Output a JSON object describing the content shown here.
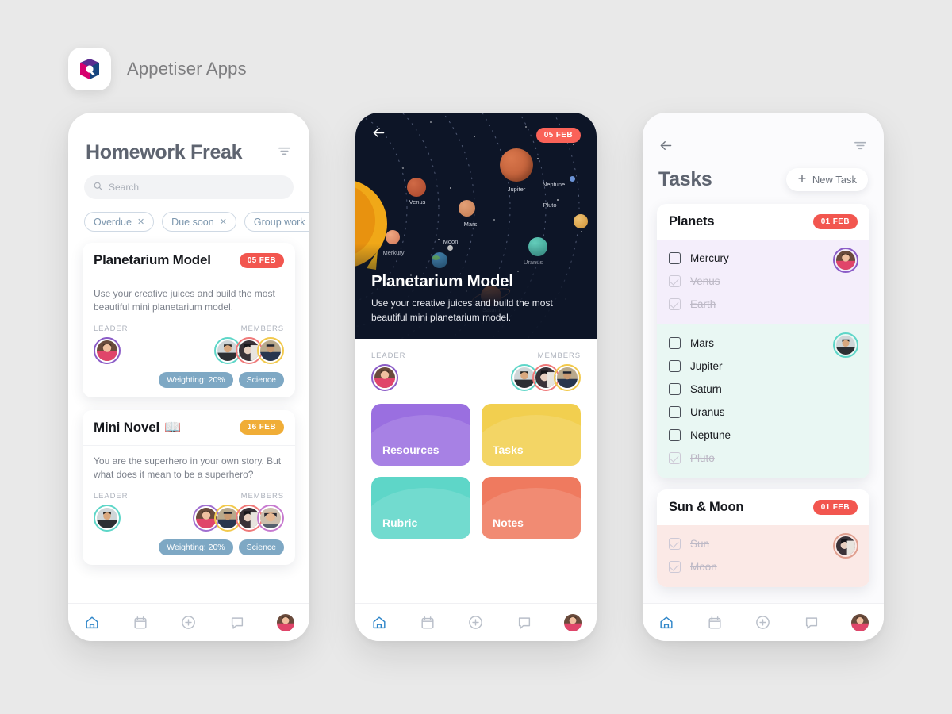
{
  "brand": {
    "name": "Appetiser Apps",
    "logo_icon": "appetiser-logo-icon"
  },
  "colors": {
    "page_bg": "#e9e9e9",
    "badge_red": "#f2564f",
    "badge_amber": "#f0ad37",
    "tag_blue": "#7ea8c4",
    "nav_active": "#2f86c9",
    "hero_bg": "#0d1527",
    "tile_purple": "#9a6fe0",
    "tile_yellow": "#f2cf4f",
    "tile_teal": "#5ed6c8",
    "tile_coral": "#ef7a5f",
    "group_lavender": "#f4eefb",
    "group_mint": "#e9f7f3",
    "group_blush": "#fbe9e6"
  },
  "screen1": {
    "title": "Homework Freak",
    "filter_icon": "filter-icon",
    "search": {
      "placeholder": "Search",
      "icon": "search-icon"
    },
    "chips": [
      {
        "label": "Overdue",
        "remove": "✕"
      },
      {
        "label": "Due soon",
        "remove": "✕"
      },
      {
        "label": "Group work",
        "remove": "✕"
      }
    ],
    "cards": [
      {
        "title": "Planetarium Model",
        "emoji": "",
        "badge": "05 FEB",
        "badge_color": "#f2564f",
        "description": "Use your creative juices and build the most beautiful mini planetarium model.",
        "leader_label": "LEADER",
        "members_label": "MEMBERS",
        "leader_ring": "#8b5cc7",
        "member_rings": [
          "#5ed6c8",
          "#ef7a7a",
          "#f2c94c"
        ],
        "tags": [
          "Weighting: 20%",
          "Science"
        ]
      },
      {
        "title": "Mini Novel",
        "emoji": "📖",
        "badge": "16 FEB",
        "badge_color": "#f0ad37",
        "description": "You are the superhero in your own story. But what does it mean to be a superhero?",
        "leader_label": "LEADER",
        "members_label": "MEMBERS",
        "leader_ring": "#5ed6c8",
        "member_rings": [
          "#a06fd0",
          "#f2c94c",
          "#ef7a7a",
          "#c77ad0"
        ],
        "tags": [
          "Weighting: 20%",
          "Science"
        ]
      }
    ]
  },
  "screen2": {
    "back_icon": "back-arrow-icon",
    "badge": "05 FEB",
    "hero_title": "Planetarium Model",
    "hero_desc": "Use your creative juices and build the most beautiful mini planetarium model.",
    "planets": [
      {
        "name": "Jupiter",
        "color": "#c0603c"
      },
      {
        "name": "Neptune",
        "color": "#5e8fd6"
      },
      {
        "name": "Pluto",
        "color": "#e0ab55"
      },
      {
        "name": "Venus",
        "color": "#c1553a"
      },
      {
        "name": "Mars",
        "color": "#d9895f"
      },
      {
        "name": "Moon",
        "color": "#cfcfcf"
      },
      {
        "name": "Uranus",
        "color": "#4fbfae"
      },
      {
        "name": "Merkury",
        "color": "#e59a79"
      },
      {
        "name": "Saturn",
        "color": "#b5603a"
      }
    ],
    "leader_label": "LEADER",
    "members_label": "MEMBERS",
    "leader_ring": "#8b5cc7",
    "member_rings": [
      "#5ed6c8",
      "#ef7a7a",
      "#f2c94c"
    ],
    "tiles": [
      {
        "label": "Resources",
        "color": "#9a6fe0"
      },
      {
        "label": "Tasks",
        "color": "#f2cf4f"
      },
      {
        "label": "Rubric",
        "color": "#5ed6c8"
      },
      {
        "label": "Notes",
        "color": "#ef7a5f"
      }
    ]
  },
  "screen3": {
    "back_icon": "back-arrow-icon",
    "filter_icon": "filter-icon",
    "title": "Tasks",
    "new_task": {
      "label": "New Task",
      "icon": "plus-icon"
    },
    "cards": [
      {
        "title": "Planets",
        "badge": "01 FEB",
        "groups": [
          {
            "bg": "#f4eefb",
            "avatar_ring": "#8b5cc7",
            "items": [
              {
                "label": "Mercury",
                "done": false
              },
              {
                "label": "Venus",
                "done": true
              },
              {
                "label": "Earth",
                "done": true
              }
            ]
          },
          {
            "bg": "#e9f7f3",
            "avatar_ring": "#5ed6c8",
            "items": [
              {
                "label": "Mars",
                "done": false
              },
              {
                "label": "Jupiter",
                "done": false
              },
              {
                "label": "Saturn",
                "done": false
              },
              {
                "label": "Uranus",
                "done": false
              },
              {
                "label": "Neptune",
                "done": false
              },
              {
                "label": "Pluto",
                "done": true
              }
            ]
          }
        ]
      },
      {
        "title": "Sun & Moon",
        "badge": "01 FEB",
        "groups": [
          {
            "bg": "#fbe9e6",
            "avatar_ring": "#e0a090",
            "items": [
              {
                "label": "Sun",
                "done": true
              },
              {
                "label": "Moon",
                "done": true
              }
            ]
          }
        ]
      }
    ]
  },
  "navbar": {
    "items": [
      {
        "icon": "home-icon",
        "active": true
      },
      {
        "icon": "calendar-icon",
        "active": false
      },
      {
        "icon": "plus-circle-icon",
        "active": false
      },
      {
        "icon": "chat-bubble-icon",
        "active": false
      },
      {
        "icon": "profile-avatar-icon",
        "active": false
      }
    ]
  }
}
